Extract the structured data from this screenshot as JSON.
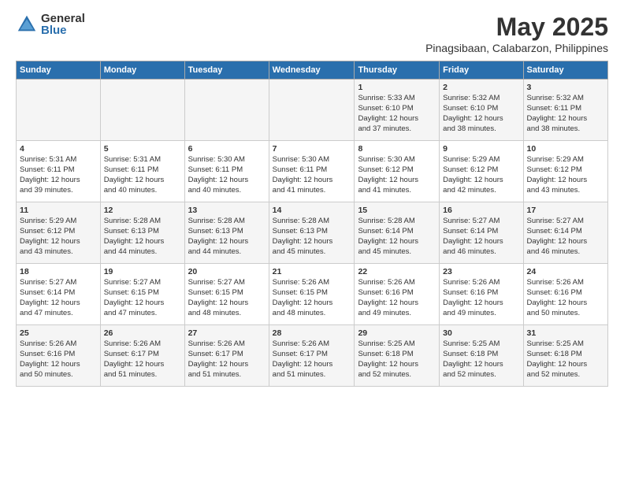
{
  "logo": {
    "general": "General",
    "blue": "Blue"
  },
  "header": {
    "title": "May 2025",
    "subtitle": "Pinagsibaan, Calabarzon, Philippines"
  },
  "weekdays": [
    "Sunday",
    "Monday",
    "Tuesday",
    "Wednesday",
    "Thursday",
    "Friday",
    "Saturday"
  ],
  "weeks": [
    [
      {
        "day": "",
        "content": ""
      },
      {
        "day": "",
        "content": ""
      },
      {
        "day": "",
        "content": ""
      },
      {
        "day": "",
        "content": ""
      },
      {
        "day": "1",
        "content": "Sunrise: 5:33 AM\nSunset: 6:10 PM\nDaylight: 12 hours\nand 37 minutes."
      },
      {
        "day": "2",
        "content": "Sunrise: 5:32 AM\nSunset: 6:10 PM\nDaylight: 12 hours\nand 38 minutes."
      },
      {
        "day": "3",
        "content": "Sunrise: 5:32 AM\nSunset: 6:11 PM\nDaylight: 12 hours\nand 38 minutes."
      }
    ],
    [
      {
        "day": "4",
        "content": "Sunrise: 5:31 AM\nSunset: 6:11 PM\nDaylight: 12 hours\nand 39 minutes."
      },
      {
        "day": "5",
        "content": "Sunrise: 5:31 AM\nSunset: 6:11 PM\nDaylight: 12 hours\nand 40 minutes."
      },
      {
        "day": "6",
        "content": "Sunrise: 5:30 AM\nSunset: 6:11 PM\nDaylight: 12 hours\nand 40 minutes."
      },
      {
        "day": "7",
        "content": "Sunrise: 5:30 AM\nSunset: 6:11 PM\nDaylight: 12 hours\nand 41 minutes."
      },
      {
        "day": "8",
        "content": "Sunrise: 5:30 AM\nSunset: 6:12 PM\nDaylight: 12 hours\nand 41 minutes."
      },
      {
        "day": "9",
        "content": "Sunrise: 5:29 AM\nSunset: 6:12 PM\nDaylight: 12 hours\nand 42 minutes."
      },
      {
        "day": "10",
        "content": "Sunrise: 5:29 AM\nSunset: 6:12 PM\nDaylight: 12 hours\nand 43 minutes."
      }
    ],
    [
      {
        "day": "11",
        "content": "Sunrise: 5:29 AM\nSunset: 6:12 PM\nDaylight: 12 hours\nand 43 minutes."
      },
      {
        "day": "12",
        "content": "Sunrise: 5:28 AM\nSunset: 6:13 PM\nDaylight: 12 hours\nand 44 minutes."
      },
      {
        "day": "13",
        "content": "Sunrise: 5:28 AM\nSunset: 6:13 PM\nDaylight: 12 hours\nand 44 minutes."
      },
      {
        "day": "14",
        "content": "Sunrise: 5:28 AM\nSunset: 6:13 PM\nDaylight: 12 hours\nand 45 minutes."
      },
      {
        "day": "15",
        "content": "Sunrise: 5:28 AM\nSunset: 6:14 PM\nDaylight: 12 hours\nand 45 minutes."
      },
      {
        "day": "16",
        "content": "Sunrise: 5:27 AM\nSunset: 6:14 PM\nDaylight: 12 hours\nand 46 minutes."
      },
      {
        "day": "17",
        "content": "Sunrise: 5:27 AM\nSunset: 6:14 PM\nDaylight: 12 hours\nand 46 minutes."
      }
    ],
    [
      {
        "day": "18",
        "content": "Sunrise: 5:27 AM\nSunset: 6:14 PM\nDaylight: 12 hours\nand 47 minutes."
      },
      {
        "day": "19",
        "content": "Sunrise: 5:27 AM\nSunset: 6:15 PM\nDaylight: 12 hours\nand 47 minutes."
      },
      {
        "day": "20",
        "content": "Sunrise: 5:27 AM\nSunset: 6:15 PM\nDaylight: 12 hours\nand 48 minutes."
      },
      {
        "day": "21",
        "content": "Sunrise: 5:26 AM\nSunset: 6:15 PM\nDaylight: 12 hours\nand 48 minutes."
      },
      {
        "day": "22",
        "content": "Sunrise: 5:26 AM\nSunset: 6:16 PM\nDaylight: 12 hours\nand 49 minutes."
      },
      {
        "day": "23",
        "content": "Sunrise: 5:26 AM\nSunset: 6:16 PM\nDaylight: 12 hours\nand 49 minutes."
      },
      {
        "day": "24",
        "content": "Sunrise: 5:26 AM\nSunset: 6:16 PM\nDaylight: 12 hours\nand 50 minutes."
      }
    ],
    [
      {
        "day": "25",
        "content": "Sunrise: 5:26 AM\nSunset: 6:16 PM\nDaylight: 12 hours\nand 50 minutes."
      },
      {
        "day": "26",
        "content": "Sunrise: 5:26 AM\nSunset: 6:17 PM\nDaylight: 12 hours\nand 51 minutes."
      },
      {
        "day": "27",
        "content": "Sunrise: 5:26 AM\nSunset: 6:17 PM\nDaylight: 12 hours\nand 51 minutes."
      },
      {
        "day": "28",
        "content": "Sunrise: 5:26 AM\nSunset: 6:17 PM\nDaylight: 12 hours\nand 51 minutes."
      },
      {
        "day": "29",
        "content": "Sunrise: 5:25 AM\nSunset: 6:18 PM\nDaylight: 12 hours\nand 52 minutes."
      },
      {
        "day": "30",
        "content": "Sunrise: 5:25 AM\nSunset: 6:18 PM\nDaylight: 12 hours\nand 52 minutes."
      },
      {
        "day": "31",
        "content": "Sunrise: 5:25 AM\nSunset: 6:18 PM\nDaylight: 12 hours\nand 52 minutes."
      }
    ]
  ]
}
